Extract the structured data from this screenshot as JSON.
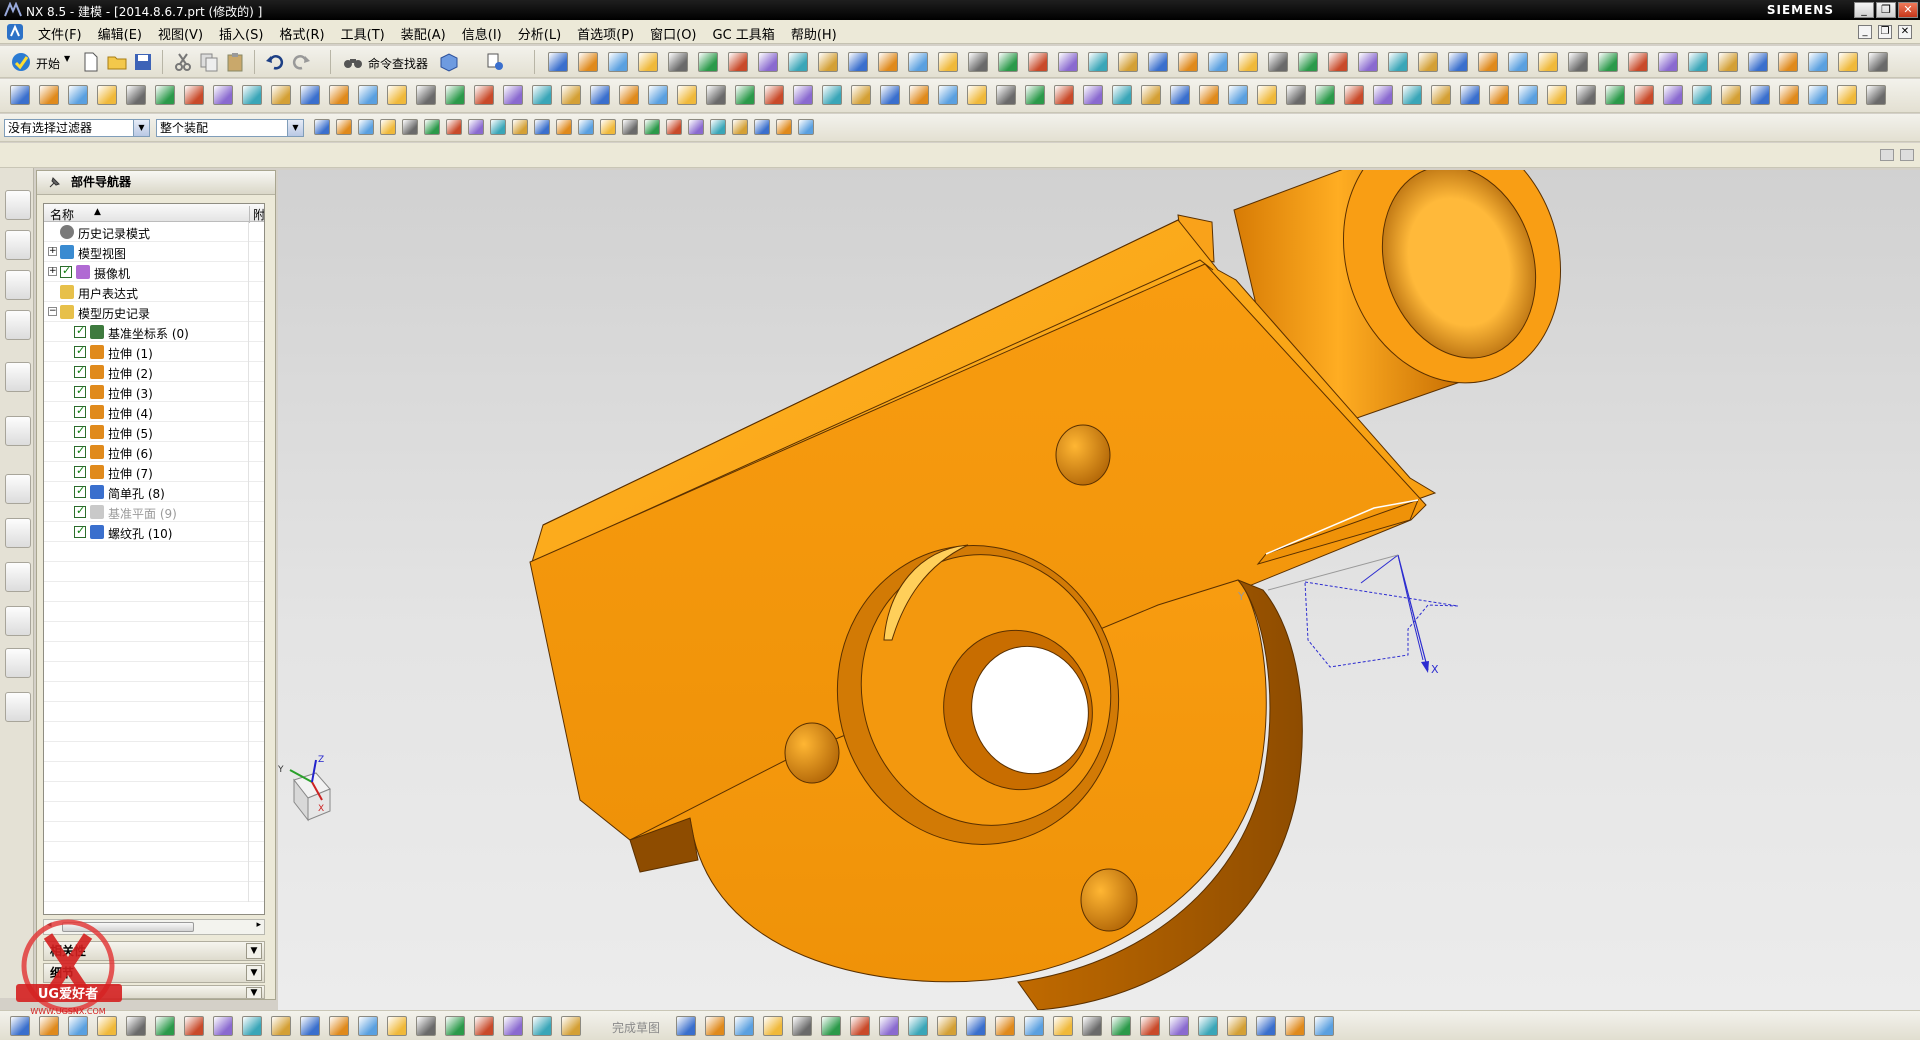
{
  "window": {
    "title": "NX 8.5 - 建模 - [2014.8.6.7.prt (修改的) ]",
    "brand": "SIEMENS",
    "minimize": "_",
    "restore": "❐",
    "close": "✕"
  },
  "menubar": {
    "items": [
      "文件(F)",
      "编辑(E)",
      "视图(V)",
      "插入(S)",
      "格式(R)",
      "工具(T)",
      "装配(A)",
      "信息(I)",
      "分析(L)",
      "首选项(P)",
      "窗口(O)",
      "GC 工具箱",
      "帮助(H)"
    ]
  },
  "standard_toolbar": {
    "start_label": "开始",
    "command_finder_label": "命令查找器"
  },
  "selection_bar": {
    "filter_value": "没有选择过滤器",
    "scope_value": "整个装配"
  },
  "navigator": {
    "title": "部件导航器",
    "col_name": "名称",
    "col_extra": "附",
    "rows": [
      {
        "label": "历史记录模式",
        "icon": "clock-icon",
        "indent": 0,
        "expander": "",
        "checked": false,
        "dim": false
      },
      {
        "label": "模型视图",
        "icon": "model-view-icon",
        "indent": 0,
        "expander": "+",
        "checked": false,
        "dim": false
      },
      {
        "label": "摄像机",
        "icon": "camera-icon",
        "indent": 0,
        "expander": "+",
        "checked": true,
        "dim": false
      },
      {
        "label": "用户表达式",
        "icon": "folder-icon",
        "indent": 0,
        "expander": "",
        "checked": false,
        "dim": false
      },
      {
        "label": "模型历史记录",
        "icon": "folder-icon",
        "indent": 0,
        "expander": "−",
        "checked": false,
        "dim": false
      },
      {
        "label": "基准坐标系 (0)",
        "icon": "datum-csys-icon",
        "indent": 1,
        "expander": "",
        "checked": true,
        "dim": false
      },
      {
        "label": "拉伸 (1)",
        "icon": "extrude-icon",
        "indent": 1,
        "expander": "",
        "checked": true,
        "dim": false
      },
      {
        "label": "拉伸 (2)",
        "icon": "extrude-icon",
        "indent": 1,
        "expander": "",
        "checked": true,
        "dim": false
      },
      {
        "label": "拉伸 (3)",
        "icon": "extrude-icon",
        "indent": 1,
        "expander": "",
        "checked": true,
        "dim": false
      },
      {
        "label": "拉伸 (4)",
        "icon": "extrude-icon",
        "indent": 1,
        "expander": "",
        "checked": true,
        "dim": false
      },
      {
        "label": "拉伸 (5)",
        "icon": "extrude-icon",
        "indent": 1,
        "expander": "",
        "checked": true,
        "dim": false
      },
      {
        "label": "拉伸 (6)",
        "icon": "extrude-icon",
        "indent": 1,
        "expander": "",
        "checked": true,
        "dim": false
      },
      {
        "label": "拉伸 (7)",
        "icon": "extrude-icon",
        "indent": 1,
        "expander": "",
        "checked": true,
        "dim": false
      },
      {
        "label": "简单孔 (8)",
        "icon": "hole-icon",
        "indent": 1,
        "expander": "",
        "checked": true,
        "dim": false
      },
      {
        "label": "基准平面 (9)",
        "icon": "datum-plane-icon",
        "indent": 1,
        "expander": "",
        "checked": true,
        "dim": true
      },
      {
        "label": "螺纹孔 (10)",
        "icon": "threaded-hole-icon",
        "indent": 1,
        "expander": "",
        "checked": true,
        "dim": false
      }
    ],
    "subpanels": [
      "相关性",
      "细节",
      "预览"
    ],
    "subpanel_states": [
      "≫",
      "≫",
      "≫"
    ]
  },
  "bottom_bar": {
    "finish_sketch_label": "完成草图"
  },
  "viewport": {
    "model_color": "#f59a0c",
    "axis_labels": {
      "x": "X",
      "y": "Y",
      "z": "Z"
    }
  },
  "watermark": {
    "text": "UG爱好者",
    "url": "WWW.UGSNX.COM"
  }
}
